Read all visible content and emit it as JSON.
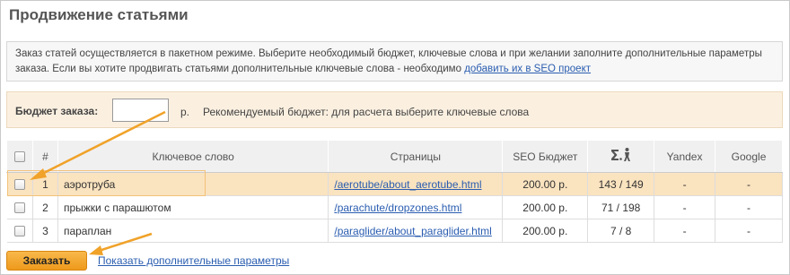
{
  "page": {
    "title": "Продвижение статьями"
  },
  "info": {
    "text": "Заказ статей осуществляется в пакетном режиме. Выберите необходимый бюджет, ключевые слова и при желании заполните дополнительные параметры заказа. Если вы хотите продвигать статьями дополнительные ключевые слова - необходимо ",
    "link": "добавить их в SEO проект"
  },
  "budget": {
    "label": "Бюджет заказа:",
    "value": "",
    "unit": "р.",
    "recommendation": "Рекомендуемый бюджет: для расчета выберите ключевые слова"
  },
  "table": {
    "headers": {
      "num": "#",
      "keyword": "Ключевое слово",
      "pages": "Страницы",
      "seo_budget": "SEO Бюджет",
      "yandex": "Yandex",
      "google": "Google"
    },
    "rows": [
      {
        "num": "1",
        "keyword": "аэротруба",
        "page": "/aerotube/about_aerotube.html",
        "budget": "200.00 р.",
        "sum": "143 / 149",
        "yandex": "-",
        "google": "-"
      },
      {
        "num": "2",
        "keyword": "прыжки с парашютом",
        "page": "/parachute/dropzones.html",
        "budget": "200.00 р.",
        "sum": "71 / 198",
        "yandex": "-",
        "google": "-"
      },
      {
        "num": "3",
        "keyword": "параплан",
        "page": "/paraglider/about_paraglider.html",
        "budget": "200.00 р.",
        "sum": "7 / 8",
        "yandex": "-",
        "google": "-"
      }
    ]
  },
  "actions": {
    "order": "Заказать",
    "more": "Показать дополнительные параметры"
  },
  "icons": {
    "sum_header": "sigma-person-icon",
    "arrow": "orange-arrow-icon"
  },
  "colors": {
    "accent": "#f0a229",
    "highlight_row": "#fae3bf",
    "link": "#2a5db0"
  }
}
